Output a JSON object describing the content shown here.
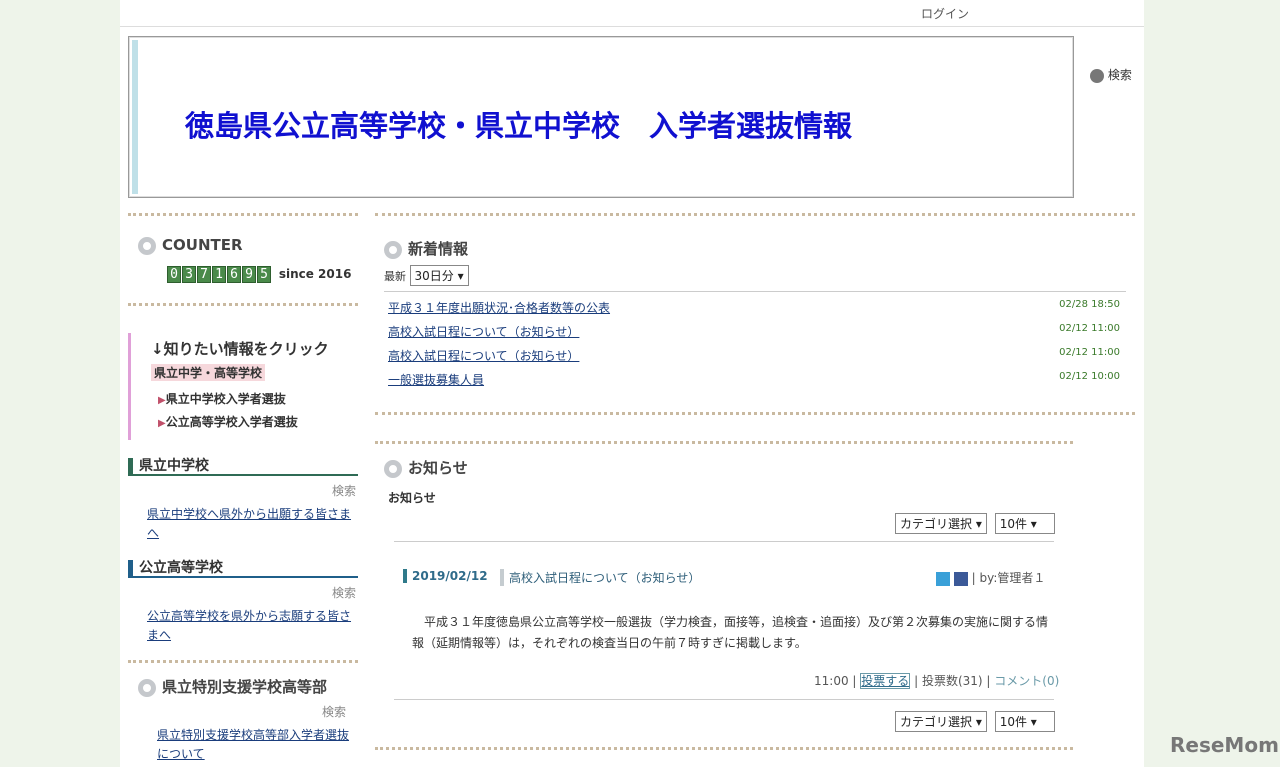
{
  "header": {
    "login": "ログイン",
    "search": "検索",
    "title": "徳島県公立高等学校・県立中学校　入学者選抜情報"
  },
  "counter": {
    "title": "COUNTER",
    "digits": [
      "0",
      "3",
      "7",
      "1",
      "6",
      "9",
      "5"
    ],
    "since": "since 2016"
  },
  "click_box": {
    "title": "↓知りたい情報をクリック",
    "tag": "県立中学・高等学校",
    "links": [
      "県立中学校入学者選抜",
      "公立高等学校入学者選抜"
    ]
  },
  "sections": [
    {
      "title": "県立中学校",
      "search": "検索",
      "link": "県立中学校へ県外から出願する皆さまへ"
    },
    {
      "title": "公立高等学校",
      "search": "検索",
      "link": "公立高等学校を県外から志願する皆さまへ"
    },
    {
      "title": "県立特別支援学校高等部",
      "search": "検索",
      "link": "県立特別支援学校高等部入学者選抜について"
    }
  ],
  "news": {
    "title": "新着情報",
    "latest_label": "最新",
    "period": "30日分",
    "items": [
      {
        "title": "平成３１年度出願状況･合格者数等の公表",
        "time": "02/28 18:50"
      },
      {
        "title": "高校入試日程について（お知らせ）",
        "time": "02/12 11:00"
      },
      {
        "title": "高校入試日程について（お知らせ）",
        "time": "02/12 11:00"
      },
      {
        "title": "一般選抜募集人員",
        "time": "02/12 10:00"
      }
    ]
  },
  "notice": {
    "title": "お知らせ",
    "subtitle": "お知らせ",
    "category": "カテゴリ選択",
    "count": "10件",
    "post": {
      "date": "2019/02/12",
      "title": "高校入試日程について（お知らせ）",
      "by": "| by:管理者１",
      "body": "　平成３１年度徳島県公立高等学校一般選抜（学力検査，面接等，追検査・追面接）及び第２次募集の実施に関する情報（延期情報等）は，それぞれの検査当日の午前７時すぎに掲載します。",
      "time": "11:00",
      "vote": "投票する",
      "votes": "投票数(31)",
      "comment": "コメント(0)"
    }
  },
  "watermark": "ReseMom"
}
